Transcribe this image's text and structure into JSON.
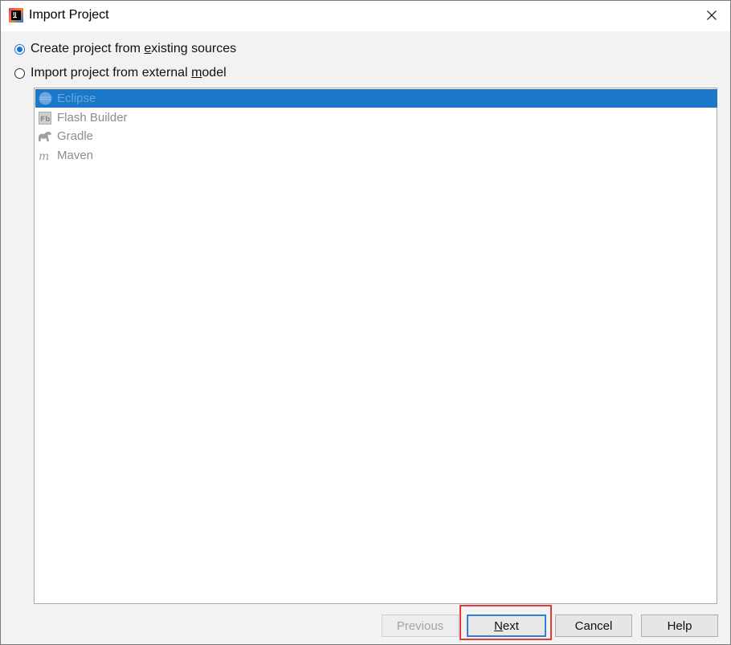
{
  "window": {
    "title": "Import Project",
    "app_icon": "intellij-idea-icon",
    "close_icon": "close-icon"
  },
  "options": [
    {
      "before": "Create project from ",
      "accel": "e",
      "after": "xisting sources",
      "checked": true
    },
    {
      "before": "Import project from external ",
      "accel": "m",
      "after": "odel",
      "checked": false
    }
  ],
  "models": [
    {
      "label": "Eclipse",
      "icon": "eclipse-icon",
      "selected": true
    },
    {
      "label": "Flash Builder",
      "icon": "flash-builder-icon",
      "selected": false
    },
    {
      "label": "Gradle",
      "icon": "gradle-icon",
      "selected": false
    },
    {
      "label": "Maven",
      "icon": "maven-icon",
      "selected": false
    }
  ],
  "buttons": {
    "previous": "Previous",
    "next_accel": "N",
    "next_rest": "ext",
    "cancel": "Cancel",
    "help": "Help"
  },
  "colors": {
    "selection": "#1b78c9",
    "highlight_border": "#e03a3a",
    "default_button_border": "#2f7fd3"
  }
}
